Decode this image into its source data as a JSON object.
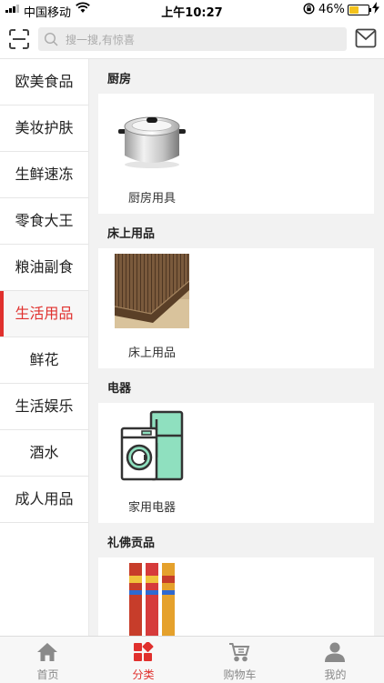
{
  "status_bar": {
    "carrier": "中国移动",
    "time": "上午10:27",
    "battery": "46%"
  },
  "search": {
    "placeholder": "搜一搜,有惊喜",
    "value": ""
  },
  "sidebar": {
    "items": [
      {
        "label": "欧美食品",
        "active": false
      },
      {
        "label": "美妆护肤",
        "active": false
      },
      {
        "label": "生鲜速冻",
        "active": false
      },
      {
        "label": "零食大王",
        "active": false
      },
      {
        "label": "粮油副食",
        "active": false
      },
      {
        "label": "生活用品",
        "active": true
      },
      {
        "label": "鲜花",
        "active": false
      },
      {
        "label": "生活娱乐",
        "active": false
      },
      {
        "label": "酒水",
        "active": false
      },
      {
        "label": "成人用品",
        "active": false
      }
    ]
  },
  "sections": [
    {
      "title": "厨房",
      "product": {
        "label": "厨房用具",
        "icon": "cooking-pot-image"
      }
    },
    {
      "title": "床上用品",
      "product": {
        "label": "床上用品",
        "icon": "bamboo-mat-image"
      }
    },
    {
      "title": "电器",
      "product": {
        "label": "家用电器",
        "icon": "appliances-image"
      }
    },
    {
      "title": "礼佛贡品",
      "product": {
        "label": "",
        "icon": "incense-sticks-image"
      }
    }
  ],
  "tabs": [
    {
      "label": "首页",
      "icon": "home-icon",
      "active": false
    },
    {
      "label": "分类",
      "icon": "category-icon",
      "active": true
    },
    {
      "label": "购物车",
      "icon": "cart-icon",
      "active": false
    },
    {
      "label": "我的",
      "icon": "user-icon",
      "active": false
    }
  ],
  "colors": {
    "accent": "#e0302d",
    "battery": "#f4c21c",
    "content_bg": "#f2f2f2"
  }
}
